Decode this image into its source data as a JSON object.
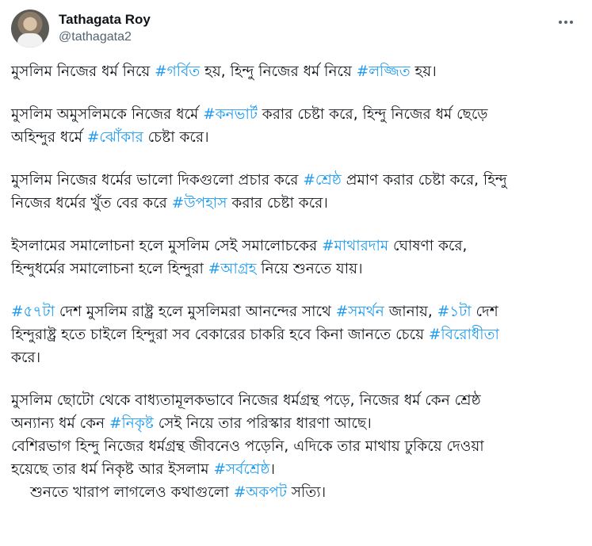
{
  "author": {
    "display_name": "Tathagata Roy",
    "handle": "@tathagata2",
    "more_icon": "more-horizontal-icon"
  },
  "tweet": {
    "paragraphs": [
      {
        "lines": [
          [
            {
              "t": "মুসলিম নিজের ধর্ম নিয়ে "
            },
            {
              "h": "#গর্বিত"
            },
            {
              "t": " হয়, হিন্দু নিজের ধর্ম নিয়ে "
            },
            {
              "h": "#লজ্জিত"
            },
            {
              "t": " হয়।"
            }
          ]
        ]
      },
      {
        "lines": [
          [
            {
              "t": "মুসলিম অমুসলিমকে নিজের ধর্মে "
            },
            {
              "h": "#কনভার্ট"
            },
            {
              "t": " করার চেষ্টা করে,  হিন্দু নিজের ধর্ম ছেড়ে"
            }
          ],
          [
            {
              "t": "অহিন্দুর ধর্মে "
            },
            {
              "h": "#ঝোঁকার"
            },
            {
              "t": " চেষ্টা করে।"
            }
          ]
        ]
      },
      {
        "lines": [
          [
            {
              "t": "মুসলিম নিজের ধর্মের ভালো দিকগুলো প্রচার করে "
            },
            {
              "h": "#শ্রেষ্ঠ"
            },
            {
              "t": " প্রমাণ করার চেষ্টা করে,  হিন্দু"
            }
          ],
          [
            {
              "t": "নিজের ধর্মের খুঁত বের করে "
            },
            {
              "h": "#উপহাস"
            },
            {
              "t": " করার চেষ্টা করে।"
            }
          ]
        ]
      },
      {
        "lines": [
          [
            {
              "t": "ইসলামের সমালোচনা হলে মুসলিম সেই সমালোচকের "
            },
            {
              "h": "#মাথারদাম"
            },
            {
              "t": " ঘোষণা করে,"
            }
          ],
          [
            {
              "t": "হিন্দুধর্মের সমালোচনা হলে হিন্দুরা "
            },
            {
              "h": "#আগ্রহ"
            },
            {
              "t": " নিয়ে শুনতে যায়।"
            }
          ]
        ]
      },
      {
        "lines": [
          [
            {
              "h": "#৫৭টা"
            },
            {
              "t": " দেশ মুসলিম রাষ্ট্র হলে মুসলিমরা আনন্দের সাথে "
            },
            {
              "h": "#সমর্থন"
            },
            {
              "t": " জানায়, "
            },
            {
              "h": "#১টা"
            },
            {
              "t": " দেশ"
            }
          ],
          [
            {
              "t": "হিন্দুরাষ্ট্র হতে চাইলে হিন্দুরা সব বেকারের চাকরি হবে কিনা জানতে চেয়ে "
            },
            {
              "h": "#বিরোধীতা"
            }
          ],
          [
            {
              "t": "করে।"
            }
          ]
        ]
      },
      {
        "tight": true,
        "lines": [
          [
            {
              "t": "মুসলিম ছোটো থেকে বাধ্যতামূলকভাবে নিজের ধর্মগ্রন্থ পড়ে, নিজের ধর্ম কেন শ্রেষ্ঠ"
            }
          ],
          [
            {
              "t": "অন্যান্য ধর্ম কেন "
            },
            {
              "h": "#নিকৃষ্ট"
            },
            {
              "t": " সেই নিয়ে তার পরিস্কার ধারণা আছে।"
            }
          ],
          [
            {
              "t": "বেশিরভাগ হিন্দু নিজের ধর্মগ্রন্থ জীবনেও পড়েনি, এদিকে তার মাথায় ঢুকিয়ে দেওয়া"
            }
          ],
          [
            {
              "t": "হয়েছে তার ধর্ম নিকৃষ্ট আর ইসলাম "
            },
            {
              "h": "#সর্বশ্রেষ্ঠ"
            },
            {
              "t": "।"
            }
          ],
          [
            {
              "t": "শুনতে খারাপ লাগলেও কথাগুলো "
            },
            {
              "h": "#অকপট"
            },
            {
              "t": " সত্যি।"
            }
          ]
        ],
        "indent_last": true
      }
    ]
  },
  "colors": {
    "hashtag": "#1d9bf0",
    "text": "#0f1419",
    "secondary": "#536471"
  }
}
